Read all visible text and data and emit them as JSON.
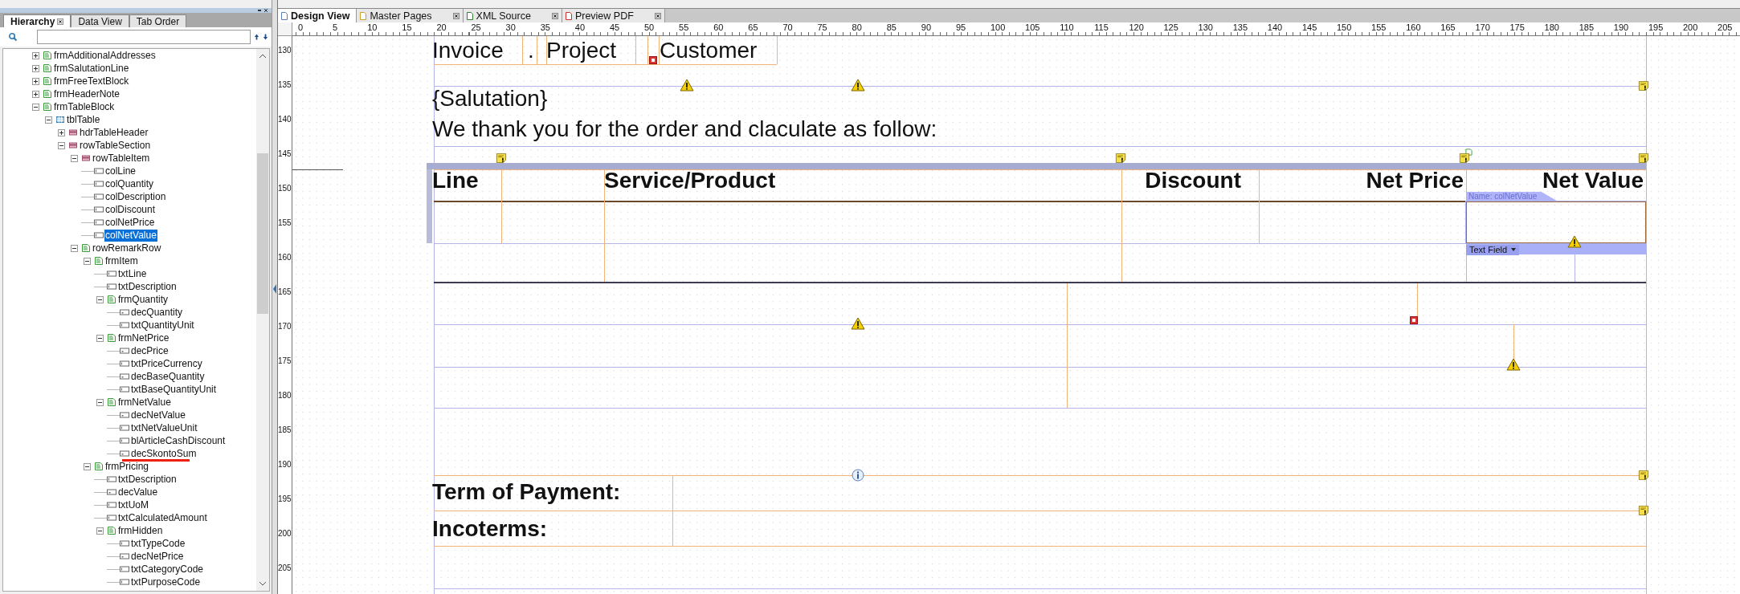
{
  "left_panel": {
    "tabs": [
      {
        "label": "Hierarchy",
        "selected": true,
        "closable": true
      },
      {
        "label": "Data View",
        "selected": false,
        "closable": false
      },
      {
        "label": "Tab Order",
        "selected": false,
        "closable": false
      }
    ],
    "tree": [
      {
        "label": "frmAdditionalAddresses",
        "kind": "subform",
        "expanded": false,
        "selected": false
      },
      {
        "label": "frmSalutationLine",
        "kind": "subform",
        "expanded": false,
        "selected": false
      },
      {
        "label": "frmFreeTextBlock",
        "kind": "subform",
        "expanded": false,
        "selected": false
      },
      {
        "label": "frmHeaderNote",
        "kind": "subform",
        "expanded": false,
        "selected": false
      },
      {
        "label": "frmTableBlock",
        "kind": "subform",
        "expanded": true,
        "selected": false,
        "children": [
          {
            "label": "tblTable",
            "kind": "table",
            "expanded": true,
            "selected": false,
            "children": [
              {
                "label": "hdrTableHeader",
                "kind": "row",
                "expanded": false,
                "selected": false
              },
              {
                "label": "rowTableSection",
                "kind": "row",
                "expanded": true,
                "selected": false,
                "children": [
                  {
                    "label": "rowTableItem",
                    "kind": "row",
                    "expanded": true,
                    "selected": false,
                    "children": [
                      {
                        "label": "colLine",
                        "kind": "field",
                        "selected": false
                      },
                      {
                        "label": "colQuantity",
                        "kind": "field",
                        "selected": false
                      },
                      {
                        "label": "colDescription",
                        "kind": "field",
                        "selected": false
                      },
                      {
                        "label": "colDiscount",
                        "kind": "field",
                        "selected": false
                      },
                      {
                        "label": "colNetPrice",
                        "kind": "field",
                        "selected": false
                      },
                      {
                        "label": "colNetValue",
                        "kind": "field",
                        "selected": true
                      }
                    ]
                  },
                  {
                    "label": "rowRemarkRow",
                    "kind": "subform",
                    "expanded": true,
                    "selected": false,
                    "children": [
                      {
                        "label": "frmItem",
                        "kind": "subform",
                        "expanded": true,
                        "selected": false,
                        "children": [
                          {
                            "label": "txtLine",
                            "kind": "field",
                            "selected": false
                          },
                          {
                            "label": "txtDescription",
                            "kind": "field",
                            "selected": false
                          },
                          {
                            "label": "frmQuantity",
                            "kind": "subform",
                            "expanded": true,
                            "selected": false,
                            "children": [
                              {
                                "label": "decQuantity",
                                "kind": "numeric",
                                "selected": false
                              },
                              {
                                "label": "txtQuantityUnit",
                                "kind": "field",
                                "selected": false
                              }
                            ]
                          },
                          {
                            "label": "frmNetPrice",
                            "kind": "subform",
                            "expanded": true,
                            "selected": false,
                            "children": [
                              {
                                "label": "decPrice",
                                "kind": "numeric",
                                "selected": false
                              },
                              {
                                "label": "txtPriceCurrency",
                                "kind": "field",
                                "selected": false
                              },
                              {
                                "label": "decBaseQuantity",
                                "kind": "numeric",
                                "selected": false
                              },
                              {
                                "label": "txtBaseQuantityUnit",
                                "kind": "field",
                                "selected": false
                              }
                            ]
                          },
                          {
                            "label": "frmNetValue",
                            "kind": "subform",
                            "expanded": true,
                            "selected": false,
                            "children": [
                              {
                                "label": "decNetValue",
                                "kind": "numeric",
                                "selected": false
                              },
                              {
                                "label": "txtNetValueUnit",
                                "kind": "field",
                                "selected": false
                              },
                              {
                                "label": "blArticleCashDiscount",
                                "kind": "field",
                                "selected": false
                              },
                              {
                                "label": "decSkontoSum",
                                "kind": "numeric",
                                "selected": false,
                                "underlined": true
                              }
                            ]
                          }
                        ]
                      },
                      {
                        "label": "frmPricing",
                        "kind": "subform",
                        "expanded": true,
                        "selected": false,
                        "children": [
                          {
                            "label": "txtDescription",
                            "kind": "field",
                            "selected": false
                          },
                          {
                            "label": "decValue",
                            "kind": "numeric",
                            "selected": false
                          },
                          {
                            "label": "txtUoM",
                            "kind": "field",
                            "selected": false
                          },
                          {
                            "label": "txtCalculatedAmount",
                            "kind": "field",
                            "selected": false
                          },
                          {
                            "label": "frmHidden",
                            "kind": "subform",
                            "expanded": true,
                            "selected": false,
                            "children": [
                              {
                                "label": "txtTypeCode",
                                "kind": "field",
                                "selected": false
                              },
                              {
                                "label": "decNetPrice",
                                "kind": "numeric",
                                "selected": false
                              },
                              {
                                "label": "txtCategoryCode",
                                "kind": "field",
                                "selected": false
                              },
                              {
                                "label": "txtPurposeCode",
                                "kind": "field",
                                "selected": false
                              }
                            ]
                          }
                        ]
                      }
                    ]
                  }
                ]
              }
            ]
          }
        ]
      }
    ]
  },
  "editor_tabs": [
    {
      "label": "Design View",
      "selected": true,
      "closable": false
    },
    {
      "label": "Master Pages",
      "selected": false,
      "closable": true
    },
    {
      "label": "XML Source",
      "selected": false,
      "closable": true
    },
    {
      "label": "Preview PDF",
      "selected": false,
      "closable": true
    }
  ],
  "ruler": {
    "horizontal": [
      "0",
      "5",
      "10",
      "15",
      "20",
      "25",
      "30",
      "35",
      "40",
      "45",
      "50",
      "55",
      "60",
      "65",
      "70",
      "75",
      "80",
      "85",
      "90",
      "95",
      "100",
      "105",
      "110",
      "115",
      "120",
      "125",
      "130",
      "135",
      "140",
      "145",
      "150",
      "155",
      "160",
      "165",
      "170",
      "175",
      "180",
      "185",
      "190",
      "195",
      "200",
      "205"
    ],
    "vertical": [
      "130",
      "135",
      "140",
      "145",
      "150",
      "155",
      "160",
      "165",
      "170",
      "175",
      "180",
      "185",
      "190",
      "195",
      "200",
      "205"
    ]
  },
  "design": {
    "header_fields": [
      "Invoice",
      ".",
      "Project",
      "Customer"
    ],
    "salutation": "{Salutation}",
    "intro": "We thank you for the order and claculate as follow:",
    "table": {
      "columns": [
        {
          "label": "Line"
        },
        {
          "label": "Service/Product"
        },
        {
          "label": "Discount"
        },
        {
          "label": "Net Price"
        },
        {
          "label": "Net Value"
        }
      ]
    },
    "selection": {
      "name": "Name: colNetValue",
      "type": "Text Field"
    },
    "footer_labels": [
      "Term of Payment:",
      "Incoterms:"
    ]
  }
}
